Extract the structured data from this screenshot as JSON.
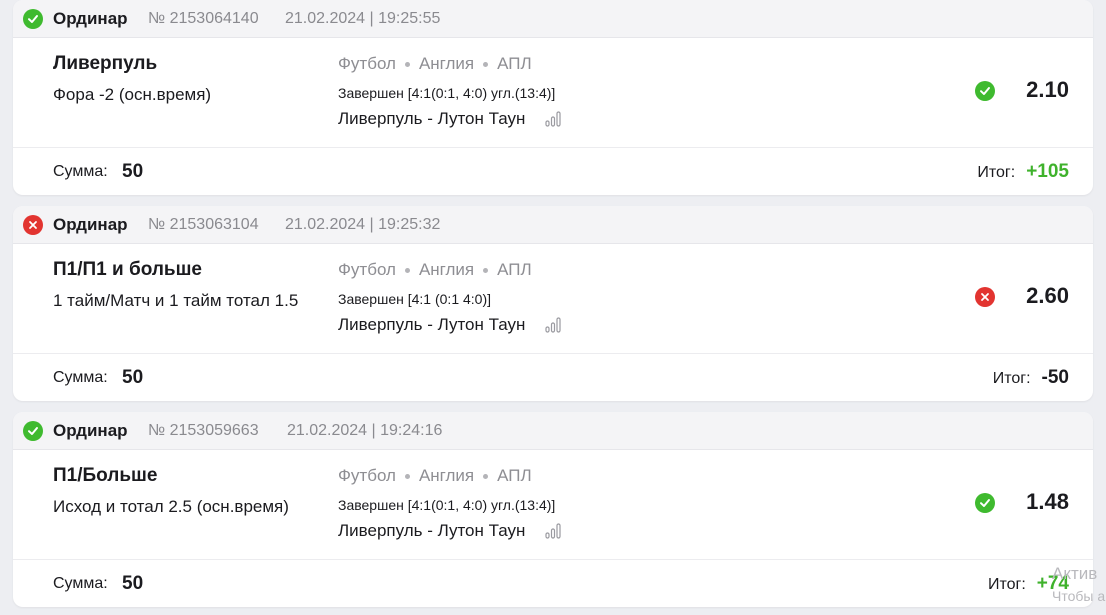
{
  "bets": [
    {
      "status": "win",
      "type": "Ординар",
      "number": "№ 2153064140",
      "datetime": "21.02.2024 | 19:25:55",
      "market": "Ливерпуль",
      "selection": "Фора -2 (осн.время)",
      "sport": "Футбол",
      "country": "Англия",
      "league": "АПЛ",
      "result": "Завершен [4:1(0:1, 4:0) угл.(13:4)]",
      "teams": "Ливерпуль - Лутон Таун",
      "odds": "2.10",
      "sum_label": "Сумма:",
      "sum": "50",
      "total_label": "Итог:",
      "total": "+105"
    },
    {
      "status": "loss",
      "type": "Ординар",
      "number": "№ 2153063104",
      "datetime": "21.02.2024 | 19:25:32",
      "market": "П1/П1 и больше",
      "selection": "1 тайм/Матч и 1 тайм тотал 1.5",
      "sport": "Футбол",
      "country": "Англия",
      "league": "АПЛ",
      "result": "Завершен [4:1 (0:1 4:0)]",
      "teams": "Ливерпуль - Лутон Таун",
      "odds": "2.60",
      "sum_label": "Сумма:",
      "sum": "50",
      "total_label": "Итог:",
      "total": "-50"
    },
    {
      "status": "win",
      "type": "Ординар",
      "number": "№ 2153059663",
      "datetime": "21.02.2024 | 19:24:16",
      "market": "П1/Больше",
      "selection": "Исход и тотал 2.5 (осн.время)",
      "sport": "Футбол",
      "country": "Англия",
      "league": "АПЛ",
      "result": "Завершен [4:1(0:1, 4:0) угл.(13:4)]",
      "teams": "Ливерпуль - Лутон Таун",
      "odds": "1.48",
      "sum_label": "Сумма:",
      "sum": "50",
      "total_label": "Итог:",
      "total": "+74"
    }
  ],
  "colors": {
    "win": "#3fba2f",
    "loss": "#e23430",
    "positive_total": "#3fb22c"
  },
  "icons": {
    "win": "check-circle-icon",
    "loss": "cross-circle-icon",
    "stats": "stats-bars-icon"
  },
  "watermark": {
    "line1": "Актив",
    "line2": "Чтобы а"
  }
}
